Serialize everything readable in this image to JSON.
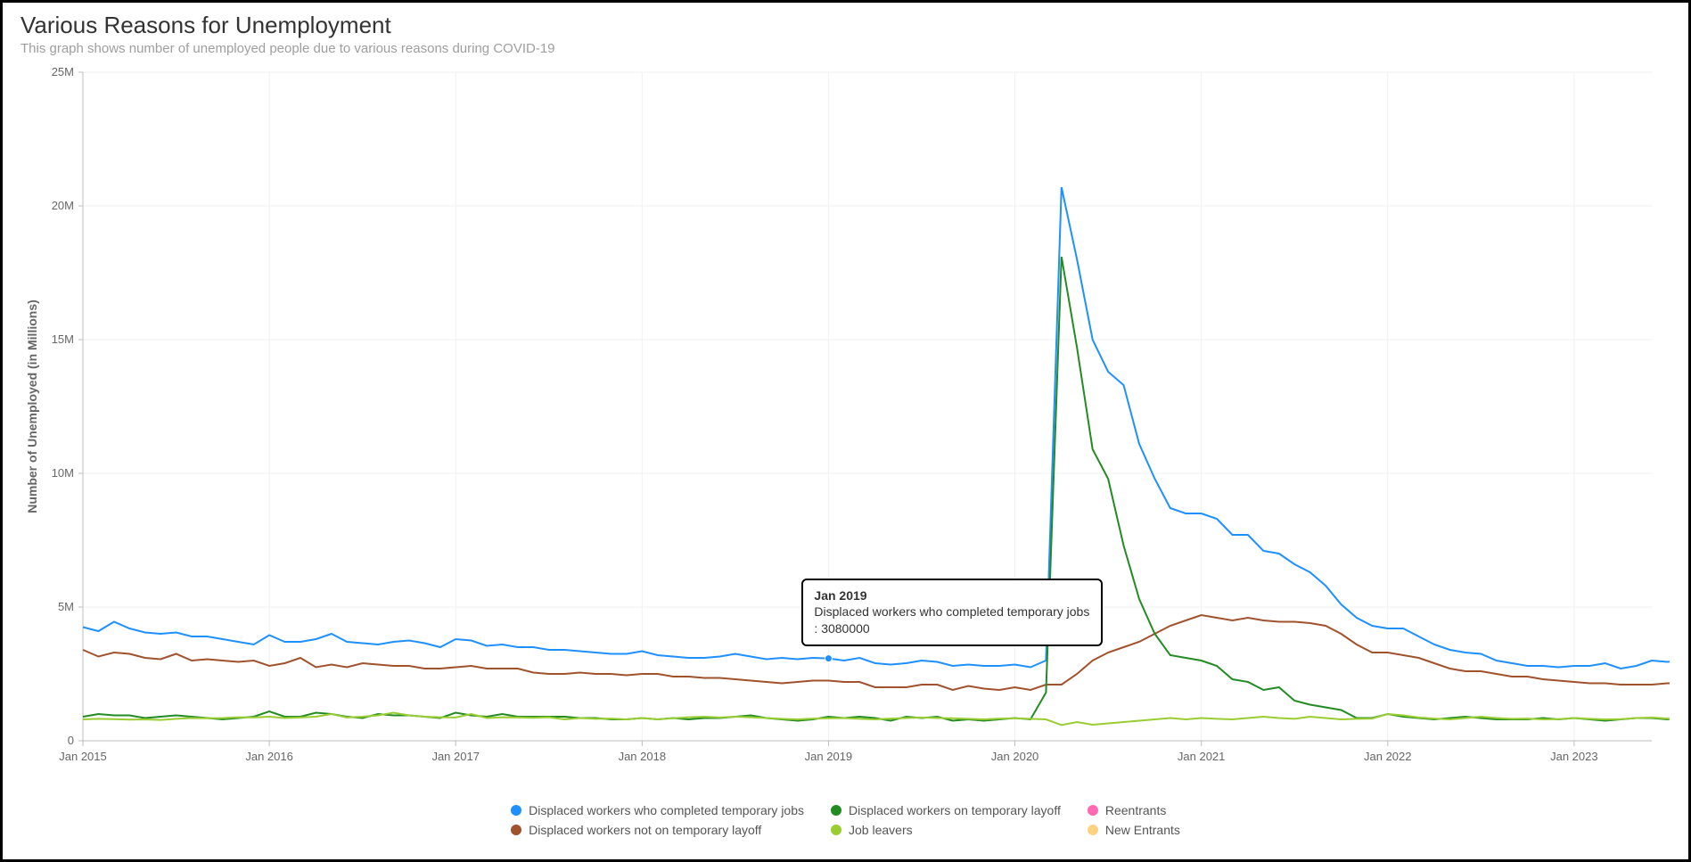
{
  "title": "Various Reasons for Unemployment",
  "subtitle": "This graph shows number of unemployed people due to various reasons during COVID-19",
  "ylabel": "Number of Unemployed (in Millions)",
  "tooltip": {
    "title": "Jan 2019",
    "body": "Displaced workers who completed temporary jobs : 3080000"
  },
  "legend": [
    {
      "id": "s1",
      "label": "Displaced workers who completed temporary jobs",
      "color": "#1e90ff"
    },
    {
      "id": "s2",
      "label": "Displaced workers not on temporary layoff",
      "color": "#a0522d"
    },
    {
      "id": "s3",
      "label": "Displaced workers on temporary layoff",
      "color": "#228B22"
    },
    {
      "id": "s4",
      "label": "Job leavers",
      "color": "#9acd32"
    },
    {
      "id": "s5",
      "label": "Reentrants",
      "color": "#ff69b4"
    },
    {
      "id": "s6",
      "label": "New Entrants",
      "color": "#ffd27f"
    }
  ],
  "chart_data": {
    "type": "line",
    "xlabel": "",
    "ylabel": "Number of Unemployed (in Millions)",
    "ylim": [
      0,
      25000000
    ],
    "y_ticks": [
      0,
      5000000,
      10000000,
      15000000,
      20000000,
      25000000
    ],
    "y_tick_labels": [
      "0",
      "5M",
      "10M",
      "15M",
      "20M",
      "25M"
    ],
    "x_major_ticks": [
      "Jan 2015",
      "Jan 2016",
      "Jan 2017",
      "Jan 2018",
      "Jan 2019",
      "Jan 2020",
      "Jan 2021",
      "Jan 2022",
      "Jan 2023"
    ],
    "x": [
      "Jan 2015",
      "Feb 2015",
      "Mar 2015",
      "Apr 2015",
      "May 2015",
      "Jun 2015",
      "Jul 2015",
      "Aug 2015",
      "Sep 2015",
      "Oct 2015",
      "Nov 2015",
      "Dec 2015",
      "Jan 2016",
      "Feb 2016",
      "Mar 2016",
      "Apr 2016",
      "May 2016",
      "Jun 2016",
      "Jul 2016",
      "Aug 2016",
      "Sep 2016",
      "Oct 2016",
      "Nov 2016",
      "Dec 2016",
      "Jan 2017",
      "Feb 2017",
      "Mar 2017",
      "Apr 2017",
      "May 2017",
      "Jun 2017",
      "Jul 2017",
      "Aug 2017",
      "Sep 2017",
      "Oct 2017",
      "Nov 2017",
      "Dec 2017",
      "Jan 2018",
      "Feb 2018",
      "Mar 2018",
      "Apr 2018",
      "May 2018",
      "Jun 2018",
      "Jul 2018",
      "Aug 2018",
      "Sep 2018",
      "Oct 2018",
      "Nov 2018",
      "Dec 2018",
      "Jan 2019",
      "Feb 2019",
      "Mar 2019",
      "Apr 2019",
      "May 2019",
      "Jun 2019",
      "Jul 2019",
      "Aug 2019",
      "Sep 2019",
      "Oct 2019",
      "Nov 2019",
      "Dec 2019",
      "Jan 2020",
      "Feb 2020",
      "Mar 2020",
      "Apr 2020",
      "May 2020",
      "Jun 2020",
      "Jul 2020",
      "Aug 2020",
      "Sep 2020",
      "Oct 2020",
      "Nov 2020",
      "Dec 2020",
      "Jan 2021",
      "Feb 2021",
      "Mar 2021",
      "Apr 2021",
      "May 2021",
      "Jun 2021",
      "Jul 2021",
      "Aug 2021",
      "Sep 2021",
      "Oct 2021",
      "Nov 2021",
      "Dec 2021",
      "Jan 2022",
      "Feb 2022",
      "Mar 2022",
      "Apr 2022",
      "May 2022",
      "Jun 2022",
      "Jul 2022",
      "Aug 2022",
      "Sep 2022",
      "Oct 2022",
      "Nov 2022",
      "Dec 2022",
      "Jan 2023",
      "Feb 2023",
      "Mar 2023",
      "Apr 2023",
      "May 2023",
      "Jun 2023"
    ],
    "series": [
      {
        "name": "Displaced workers who completed temporary jobs",
        "color": "#1e90ff",
        "values": [
          4250000,
          4100000,
          4450000,
          4200000,
          4050000,
          4000000,
          4050000,
          3900000,
          3900000,
          3800000,
          3700000,
          3600000,
          3950000,
          3700000,
          3700000,
          3800000,
          4000000,
          3700000,
          3650000,
          3600000,
          3700000,
          3750000,
          3650000,
          3500000,
          3800000,
          3750000,
          3550000,
          3600000,
          3500000,
          3500000,
          3400000,
          3400000,
          3350000,
          3300000,
          3250000,
          3250000,
          3350000,
          3200000,
          3150000,
          3100000,
          3100000,
          3150000,
          3250000,
          3150000,
          3050000,
          3100000,
          3050000,
          3100000,
          3080000,
          3000000,
          3100000,
          2900000,
          2850000,
          2900000,
          3000000,
          2950000,
          2800000,
          2850000,
          2800000,
          2800000,
          2850000,
          2750000,
          3000000,
          20700000,
          18000000,
          15000000,
          13800000,
          13300000,
          11100000,
          9800000,
          8700000,
          8500000,
          8500000,
          8300000,
          7700000,
          7700000,
          7100000,
          7000000,
          6600000,
          6300000,
          5800000,
          5100000,
          4600000,
          4300000,
          4200000,
          4200000,
          3900000,
          3600000,
          3400000,
          3300000,
          3250000,
          3000000,
          2900000,
          2800000,
          2800000,
          2750000,
          2800000,
          2800000,
          2900000,
          2700000,
          2800000,
          3000000,
          2950000,
          3000000
        ]
      },
      {
        "name": "Displaced workers not on temporary layoff",
        "color": "#a0522d",
        "values": [
          3400000,
          3150000,
          3300000,
          3250000,
          3100000,
          3050000,
          3250000,
          3000000,
          3050000,
          3000000,
          2950000,
          3000000,
          2800000,
          2900000,
          3100000,
          2750000,
          2850000,
          2750000,
          2900000,
          2850000,
          2800000,
          2800000,
          2700000,
          2700000,
          2750000,
          2800000,
          2700000,
          2700000,
          2700000,
          2550000,
          2500000,
          2500000,
          2550000,
          2500000,
          2500000,
          2450000,
          2500000,
          2500000,
          2400000,
          2400000,
          2350000,
          2350000,
          2300000,
          2250000,
          2200000,
          2150000,
          2200000,
          2250000,
          2250000,
          2200000,
          2200000,
          2000000,
          2000000,
          2000000,
          2100000,
          2100000,
          1900000,
          2050000,
          1950000,
          1900000,
          2000000,
          1900000,
          2100000,
          2100000,
          2500000,
          3000000,
          3300000,
          3500000,
          3700000,
          4000000,
          4300000,
          4500000,
          4700000,
          4600000,
          4500000,
          4600000,
          4500000,
          4450000,
          4450000,
          4400000,
          4300000,
          4000000,
          3600000,
          3300000,
          3300000,
          3200000,
          3100000,
          2900000,
          2700000,
          2600000,
          2600000,
          2500000,
          2400000,
          2400000,
          2300000,
          2250000,
          2200000,
          2150000,
          2150000,
          2100000,
          2100000,
          2100000,
          2150000,
          2150000
        ]
      },
      {
        "name": "Displaced workers on temporary layoff",
        "color": "#228B22",
        "values": [
          900000,
          1000000,
          950000,
          950000,
          850000,
          900000,
          950000,
          900000,
          850000,
          800000,
          850000,
          900000,
          1100000,
          900000,
          900000,
          1050000,
          1000000,
          900000,
          850000,
          1000000,
          950000,
          950000,
          900000,
          850000,
          1050000,
          950000,
          900000,
          1000000,
          900000,
          900000,
          900000,
          900000,
          850000,
          850000,
          800000,
          800000,
          850000,
          800000,
          850000,
          800000,
          850000,
          850000,
          900000,
          950000,
          850000,
          800000,
          750000,
          800000,
          900000,
          850000,
          900000,
          850000,
          750000,
          900000,
          850000,
          900000,
          750000,
          800000,
          750000,
          800000,
          850000,
          800000,
          1800000,
          18100000,
          14700000,
          10900000,
          9800000,
          7300000,
          5300000,
          4000000,
          3200000,
          3100000,
          3000000,
          2800000,
          2300000,
          2200000,
          1900000,
          2000000,
          1500000,
          1350000,
          1250000,
          1150000,
          850000,
          850000,
          1000000,
          900000,
          850000,
          800000,
          850000,
          900000,
          850000,
          800000,
          800000,
          800000,
          850000,
          800000,
          850000,
          800000,
          750000,
          800000,
          850000,
          850000,
          800000,
          850000
        ]
      },
      {
        "name": "Job leavers",
        "color": "#9acd32",
        "values": [
          800000,
          820000,
          810000,
          790000,
          800000,
          780000,
          820000,
          850000,
          840000,
          850000,
          880000,
          870000,
          900000,
          850000,
          870000,
          900000,
          1000000,
          870000,
          900000,
          950000,
          1050000,
          950000,
          900000,
          880000,
          870000,
          1000000,
          850000,
          880000,
          870000,
          860000,
          880000,
          800000,
          850000,
          820000,
          830000,
          800000,
          850000,
          800000,
          840000,
          880000,
          900000,
          870000,
          900000,
          880000,
          850000,
          820000,
          800000,
          830000,
          840000,
          850000,
          820000,
          800000,
          830000,
          850000,
          870000,
          850000,
          840000,
          820000,
          800000,
          830000,
          840000,
          820000,
          800000,
          590000,
          700000,
          600000,
          650000,
          700000,
          750000,
          800000,
          850000,
          800000,
          850000,
          820000,
          800000,
          850000,
          900000,
          850000,
          820000,
          900000,
          850000,
          800000,
          820000,
          830000,
          1000000,
          950000,
          870000,
          830000,
          800000,
          850000,
          900000,
          850000,
          820000,
          830000,
          800000,
          810000,
          850000,
          820000,
          800000,
          810000,
          850000,
          870000,
          830000,
          800000
        ]
      },
      {
        "name": "Reentrants",
        "color": "#ff69b4",
        "values": []
      },
      {
        "name": "New Entrants",
        "color": "#ffd27f",
        "values": []
      }
    ],
    "grid": true,
    "legend_position": "bottom"
  }
}
